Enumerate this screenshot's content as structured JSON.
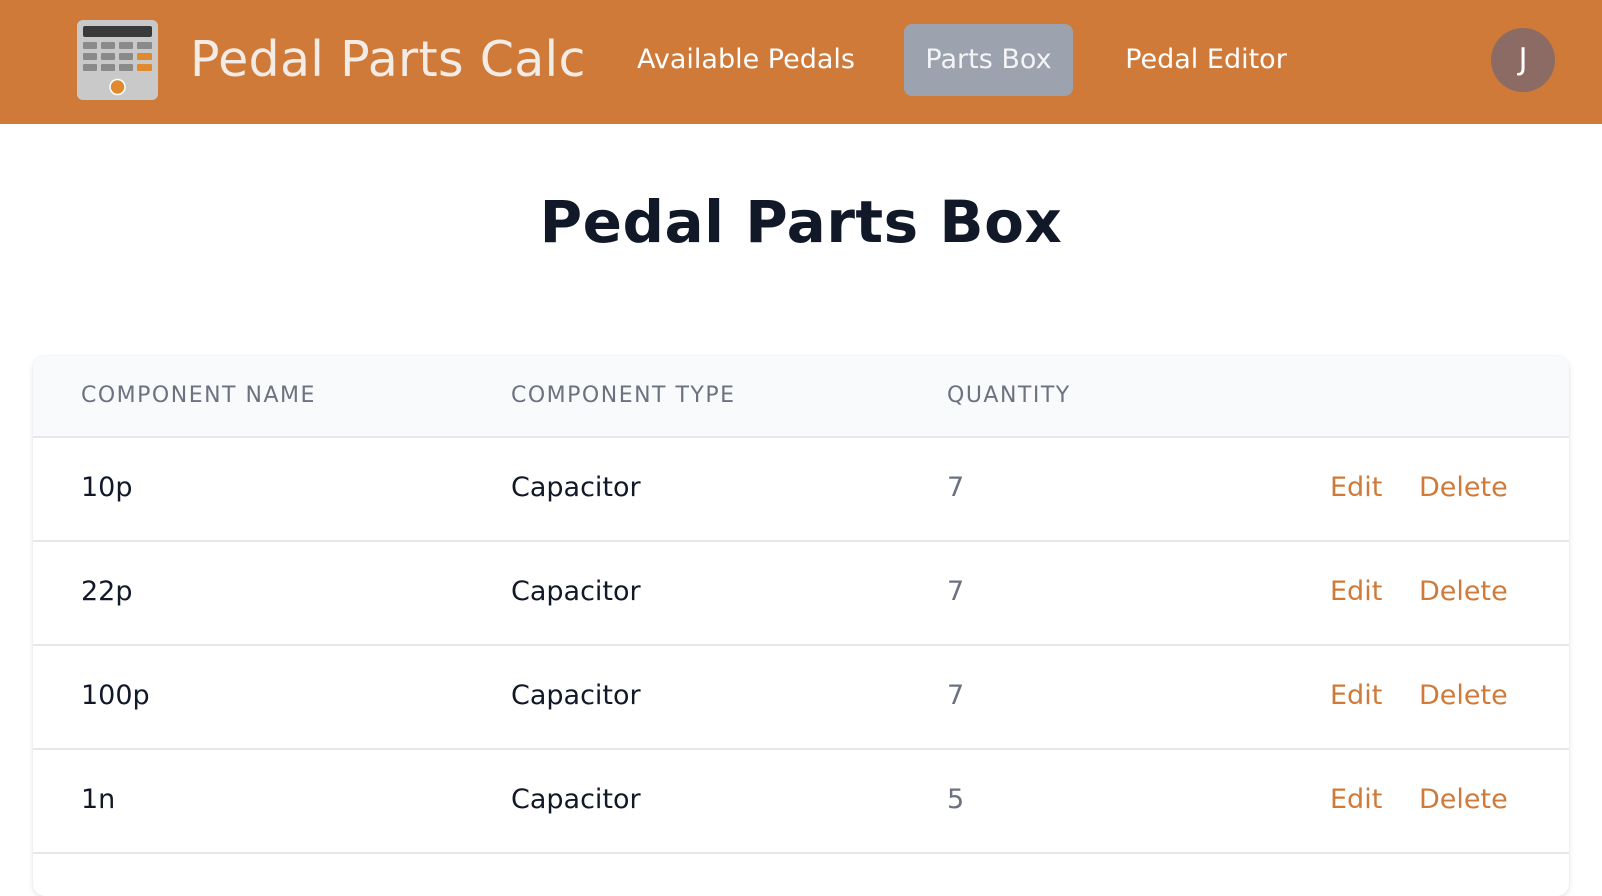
{
  "app": {
    "brand": "Pedal Parts Calc",
    "logo_icon": "calculator-icon",
    "accent_color": "#cf7a38",
    "active_tab_color": "#9ca3af"
  },
  "nav": {
    "items": [
      {
        "label": "Available Pedals",
        "active": false
      },
      {
        "label": "Parts Box",
        "active": true
      },
      {
        "label": "Pedal Editor",
        "active": false
      }
    ],
    "avatar_initial": "J"
  },
  "page": {
    "title": "Pedal Parts Box"
  },
  "table": {
    "headers": {
      "name": "COMPONENT NAME",
      "type": "COMPONENT TYPE",
      "quantity": "QUANTITY"
    },
    "rows": [
      {
        "name": "10p",
        "type": "Capacitor",
        "quantity": "7",
        "edit": "Edit",
        "delete": "Delete"
      },
      {
        "name": "22p",
        "type": "Capacitor",
        "quantity": "7",
        "edit": "Edit",
        "delete": "Delete"
      },
      {
        "name": "100p",
        "type": "Capacitor",
        "quantity": "7",
        "edit": "Edit",
        "delete": "Delete"
      },
      {
        "name": "1n",
        "type": "Capacitor",
        "quantity": "5",
        "edit": "Edit",
        "delete": "Delete"
      }
    ]
  }
}
